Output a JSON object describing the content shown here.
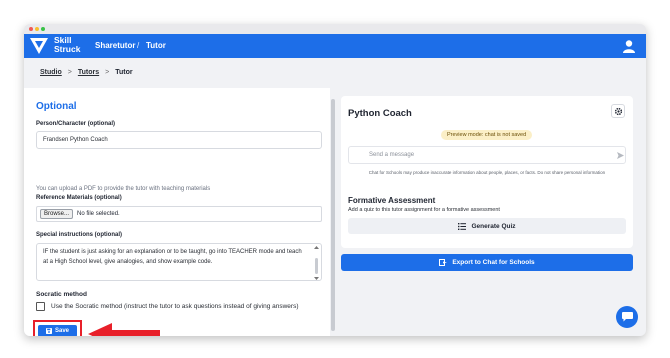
{
  "header": {
    "logo_line1": "Skill",
    "logo_line2": "Struck",
    "title": "Sharetutor",
    "separator": "/",
    "subtitle": "Tutor",
    "brand_color": "#1d6ee8"
  },
  "breadcrumb": {
    "items": [
      "Studio",
      "Tutors",
      "Tutor"
    ],
    "separator": ">"
  },
  "form": {
    "section_title": "Optional",
    "persona_label": "Person/Character (optional)",
    "persona_value": "Frandsen Python Coach",
    "upload_helper": "You can upload a PDF to provide the tutor with teaching materials",
    "reference_label": "Reference Materials (optional)",
    "browse_label": "Browse...",
    "no_file_label": "No file selected.",
    "instructions_label": "Special instructions (optional)",
    "instructions_value": "IF the student is just asking for an explanation or to be taught, go into TEACHER mode and teach at a High School level, give analogies, and show example code.",
    "socratic_title": "Socratic method",
    "socratic_label": "Use the Socratic method (instruct the tutor to ask questions instead of giving answers)",
    "socratic_checked": false,
    "save_label": "Save",
    "highlight_color": "#e8202a"
  },
  "preview": {
    "title": "Python Coach",
    "badge": "Preview mode: chat is not saved",
    "message_placeholder": "Send a message",
    "disclaimer": "Chat for Schools may produce inaccurate information about people, places, or facts. Do not share personal information",
    "assessment_title": "Formative Assessment",
    "assessment_sub": "Add a quiz to this tutor assignment for a formative assessment",
    "quiz_label": "Generate Quiz",
    "export_label": "Export to Chat for Schools"
  },
  "icons": [
    "skillstruck-logo-icon",
    "user-icon",
    "gear-icon",
    "send-icon",
    "list-icon",
    "export-icon",
    "save-icon",
    "chat-icon",
    "arrow-icon"
  ]
}
